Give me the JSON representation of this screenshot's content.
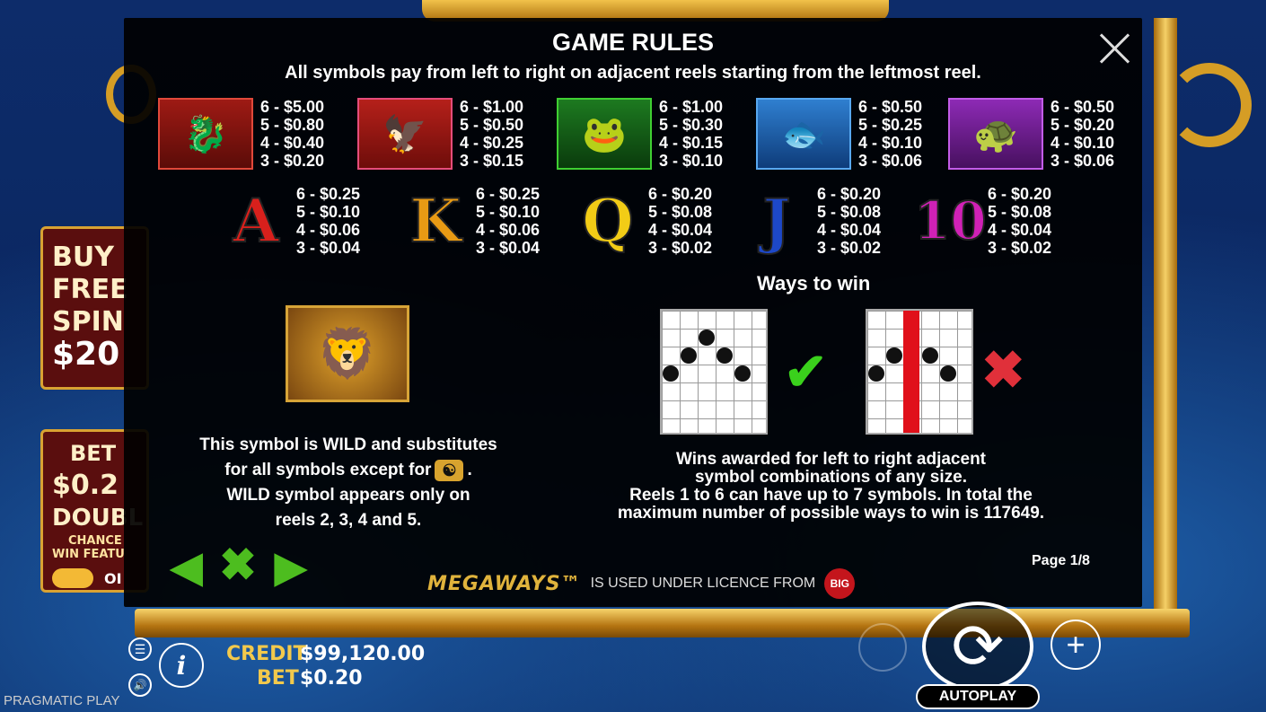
{
  "game_rules": {
    "title": "GAME RULES",
    "subtitle": "All symbols pay from left to right on adjacent reels starting from the leftmost reel.",
    "high_symbols": [
      {
        "name": "dragon",
        "pays": [
          "6 - $5.00",
          "5 - $0.80",
          "4 - $0.40",
          "3 - $0.20"
        ]
      },
      {
        "name": "phoenix",
        "pays": [
          "6 - $1.00",
          "5 - $0.50",
          "4 - $0.25",
          "3 - $0.15"
        ]
      },
      {
        "name": "toad",
        "pays": [
          "6 - $1.00",
          "5 - $0.30",
          "4 - $0.15",
          "3 - $0.10"
        ]
      },
      {
        "name": "koi",
        "pays": [
          "6 - $0.50",
          "5 - $0.25",
          "4 - $0.10",
          "3 - $0.06"
        ]
      },
      {
        "name": "turtle",
        "pays": [
          "6 - $0.50",
          "5 - $0.20",
          "4 - $0.10",
          "3 - $0.06"
        ]
      }
    ],
    "low_symbols": [
      {
        "letter": "A",
        "color": "#d8201c",
        "pays": [
          "6 - $0.25",
          "5 - $0.10",
          "4 - $0.06",
          "3 - $0.04"
        ]
      },
      {
        "letter": "K",
        "color": "#e89a14",
        "pays": [
          "6 - $0.25",
          "5 - $0.10",
          "4 - $0.06",
          "3 - $0.04"
        ]
      },
      {
        "letter": "Q",
        "color": "#f2cc16",
        "pays": [
          "6 - $0.20",
          "5 - $0.08",
          "4 - $0.04",
          "3 - $0.02"
        ]
      },
      {
        "letter": "J",
        "color": "#1d48c8",
        "pays": [
          "6 - $0.20",
          "5 - $0.08",
          "4 - $0.04",
          "3 - $0.02"
        ]
      },
      {
        "letter": "10",
        "color": "#d021b6",
        "pays": [
          "6 - $0.20",
          "5 - $0.08",
          "4 - $0.04",
          "3 - $0.02"
        ]
      }
    ],
    "wild": {
      "line1": "This symbol is WILD and substitutes",
      "line2a": "for all symbols except for",
      "line2b": ".",
      "line3": "WILD symbol appears only on",
      "line4": "reels 2, 3, 4 and 5."
    },
    "ways": {
      "title": "Ways to win",
      "line1": "Wins awarded for left to right adjacent",
      "line2": "symbol combinations of any size.",
      "line3": "Reels 1 to 6 can have up to 7 symbols. In total the",
      "line4": "maximum number of possible ways to win is 117649."
    },
    "page": "Page 1/8",
    "licence": {
      "mega": "MEGAWAYS™",
      "text": "IS USED UNDER LICENCE FROM",
      "logo": "BIG"
    }
  },
  "side": {
    "buy": {
      "line1": "BUY",
      "line2": "FREE",
      "line3": "SPIN",
      "price": "$20"
    },
    "bet": {
      "line1": "BET",
      "line2": "$0.2",
      "line3": "DOUBL",
      "line4": "CHANCE",
      "line5": "WIN FEATU",
      "toggle": "OI"
    }
  },
  "hud": {
    "credit_label": "CREDIT",
    "credit_value": "$99,120.00",
    "bet_label": "BET",
    "bet_value": "$0.20",
    "autoplay": "AUTOPLAY",
    "brand": "PRAGMATIC PLAY",
    "info_icon": "i",
    "plus_icon": "+"
  }
}
